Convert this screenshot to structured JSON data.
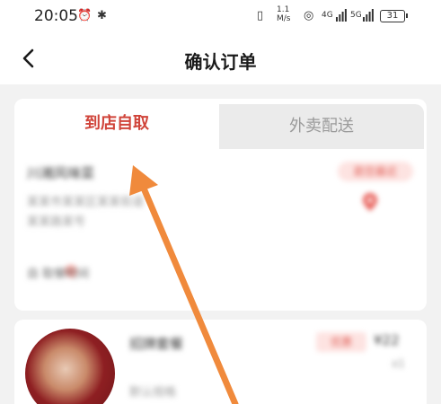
{
  "status_bar": {
    "time": "20:05",
    "alarm_icon": "⏰",
    "bluetooth_icon": "✱",
    "vibrate_icon": "▯",
    "net_speed": "1.1 M/s",
    "hotspot_icon": "◎",
    "signal_1": "4G",
    "signal_2": "5G",
    "battery": "31"
  },
  "header": {
    "title": "确认订单",
    "back_icon": "chevron-left-icon"
  },
  "tabs": [
    {
      "label": "到店自取",
      "active": true
    },
    {
      "label": "外卖配送",
      "active": false
    }
  ],
  "store": {
    "name": "川湘风味菜",
    "tag": "距您最近",
    "address": "某某市某某区某某街道",
    "address2": "某某路某号",
    "pickup": "自 取餐时间"
  },
  "product": {
    "name": "招牌套餐",
    "tag": "优惠",
    "price": "¥22",
    "qty": "x1",
    "spec": "默认规格"
  },
  "colors": {
    "accent": "#d0443a",
    "arrow": "#f08a3c",
    "background": "#f2f2f2"
  }
}
